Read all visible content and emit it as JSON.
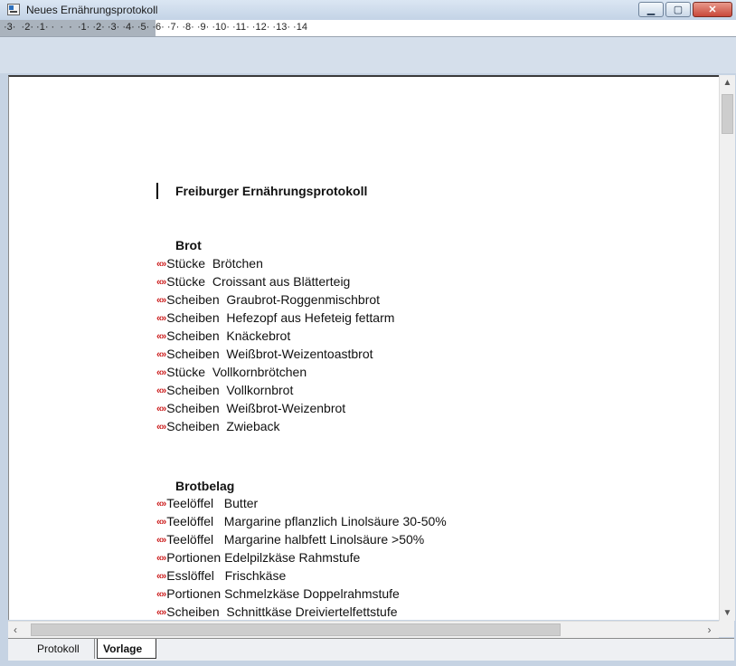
{
  "window": {
    "title": "Neues Ernährungsprotokoll"
  },
  "ruler": {
    "text": "·3·  ·2· ·1· ·  ·  ·  ·1· ·2· ·3· ·4· ·5· ·6· ·7· ·8· ·9· ·10· ·11· ·12· ·13· ·14"
  },
  "document": {
    "heading": "Freiburger Ernährungsprotokoll",
    "marker": "«»",
    "sections": [
      {
        "title": "Brot",
        "items": [
          "Stücke  Brötchen",
          "Stücke  Croissant aus Blätterteig",
          "Scheiben  Graubrot-Roggenmischbrot",
          "Scheiben  Hefezopf aus Hefeteig fettarm",
          "Scheiben  Knäckebrot",
          "Scheiben  Weißbrot-Weizentoastbrot",
          "Stücke  Vollkornbrötchen",
          "Scheiben  Vollkornbrot",
          "Scheiben  Weißbrot-Weizenbrot",
          "Scheiben  Zwieback"
        ]
      },
      {
        "title": "Brotbelag",
        "items": [
          "Teelöffel   Butter",
          "Teelöffel   Margarine pflanzlich Linolsäure 30-50%",
          "Teelöffel   Margarine halbfett Linolsäure >50%",
          "Portionen Edelpilzkäse Rahmstufe",
          "Esslöffel   Frischkäse",
          "Portionen Schmelzkäse Doppelrahmstufe",
          "Scheiben  Schnittkäse Dreiviertelfettstufe"
        ]
      }
    ]
  },
  "tabs": [
    {
      "label": "Protokoll",
      "active": false
    },
    {
      "label": "Vorlage",
      "active": true
    }
  ],
  "colors": {
    "marker": "#cc1f1f",
    "titlebar": "#c3d3e6",
    "close": "#c9483a"
  }
}
